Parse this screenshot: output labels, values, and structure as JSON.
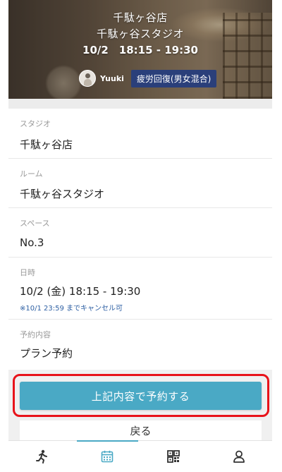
{
  "hero": {
    "store": "千駄ヶ谷店",
    "studio": "千駄ヶ谷スタジオ",
    "datetime": "10/2　18:15 - 19:30",
    "instructor": "Yuuki",
    "program_tag": "疲労回復(男女混合)"
  },
  "details": {
    "studio_label": "スタジオ",
    "studio_value": "千駄ヶ谷店",
    "room_label": "ルーム",
    "room_value": "千駄ヶ谷スタジオ",
    "space_label": "スペース",
    "space_value": "No.3",
    "datetime_label": "日時",
    "datetime_value": "10/2 (金) 18:15 - 19:30",
    "cancel_note": "※10/1 23:59 までキャンセル可",
    "booking_label": "予約内容",
    "booking_value": "プラン予約"
  },
  "actions": {
    "reserve_label": "上記内容で予約する",
    "back_label": "戻る"
  },
  "nav": {
    "items": [
      {
        "icon": "running-person-icon",
        "active": false
      },
      {
        "icon": "calendar-icon",
        "active": true
      },
      {
        "icon": "qr-code-icon",
        "active": false
      },
      {
        "icon": "user-icon",
        "active": false
      }
    ]
  },
  "colors": {
    "accent": "#4aa9c5",
    "tag_bg": "#2a3f7a",
    "highlight": "#e8131a",
    "note": "#2d5fa3"
  }
}
